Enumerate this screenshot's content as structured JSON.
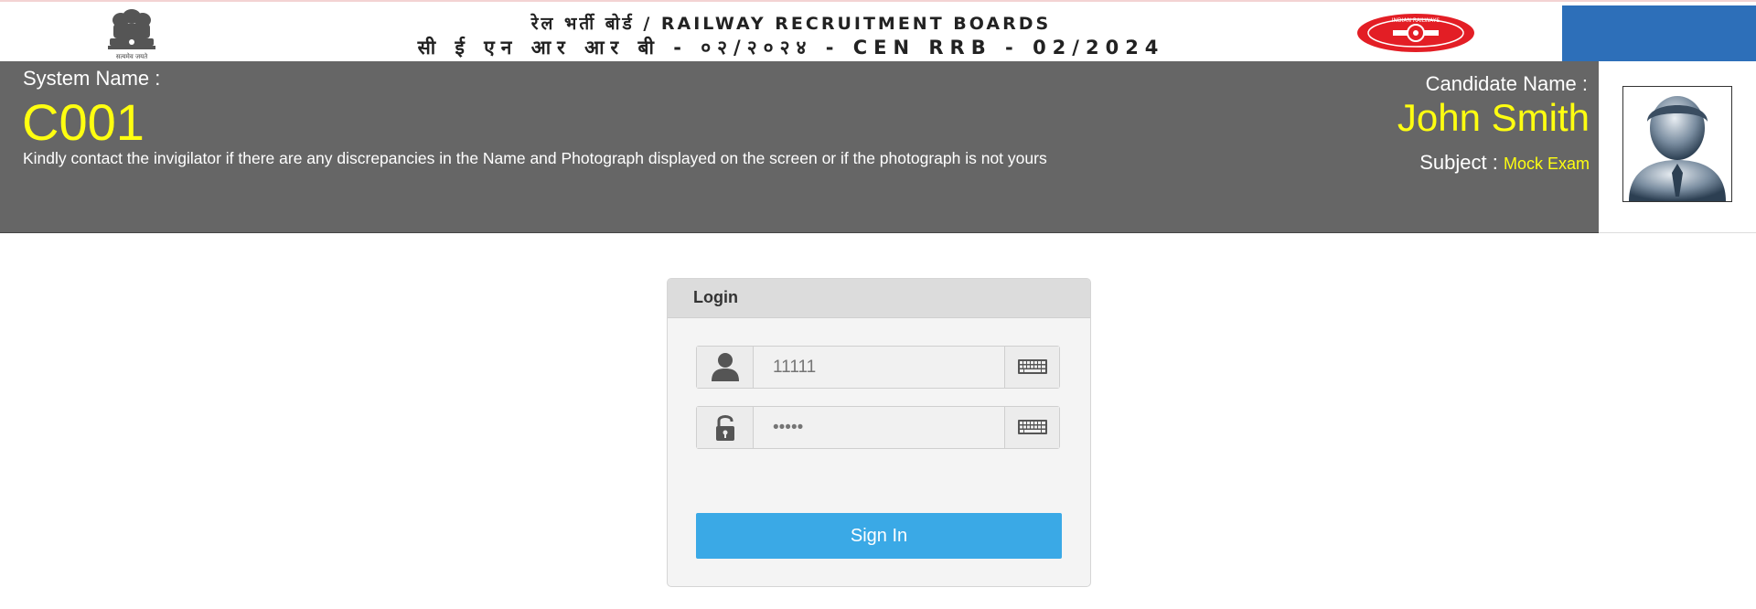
{
  "banner": {
    "line1": "रेल भर्ती बोर्ड / RAILWAY RECRUITMENT BOARDS",
    "line2": "सी ई एन आर आर बी - ०२/२०२४ - CEN RRB - 02/2024",
    "emblem_motto": "सत्यमेव जयते",
    "rail_logo_text": "INDIAN RAILWAYS"
  },
  "header": {
    "system_name_label": "System Name :",
    "system_name_value": "C001",
    "notice": "Kindly contact the invigilator if there are any discrepancies in the Name and Photograph displayed on the screen or if the photograph is not yours",
    "candidate_name_label": "Candidate Name :",
    "candidate_name_value": "John Smith",
    "subject_label": "Subject :",
    "subject_value": "Mock Exam"
  },
  "login": {
    "title": "Login",
    "username_placeholder": "11111",
    "password_placeholder": "•••••",
    "signin_label": "Sign In"
  },
  "colors": {
    "header_bg": "#666666",
    "highlight_yellow": "#ffff10",
    "signin_blue": "#3aa9e6",
    "banner_blue": "#2d6fb9",
    "rail_red": "#e31e25"
  },
  "icons": {
    "username": "user-icon",
    "password": "padlock-icon",
    "keyboard": "keyboard-icon"
  }
}
